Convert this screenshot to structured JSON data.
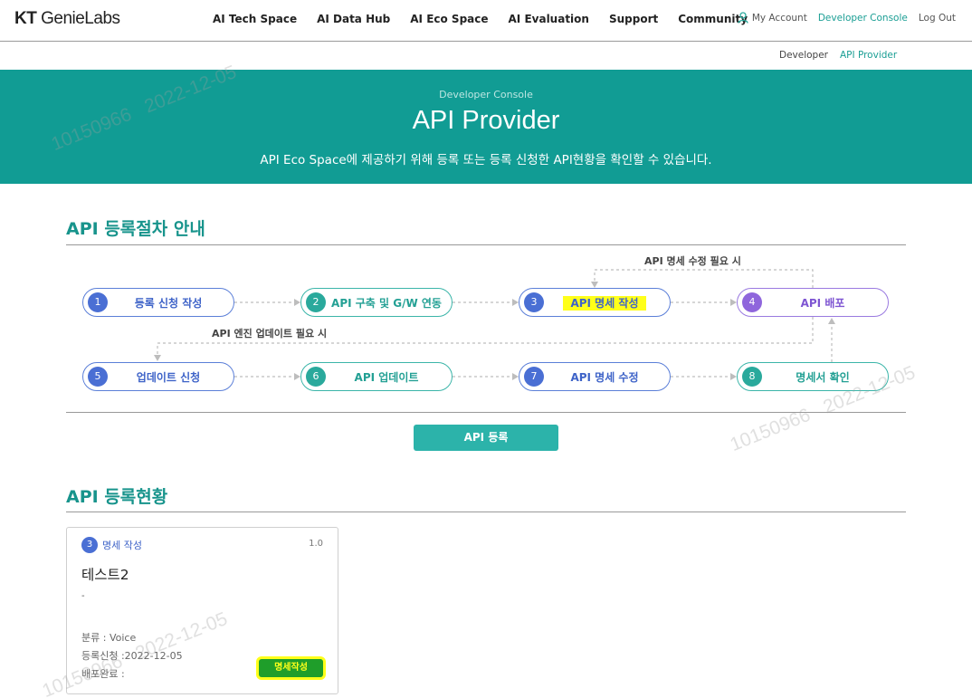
{
  "header": {
    "logo_prefix": "KT",
    "logo_name": "GenieLabs",
    "nav": [
      "AI Tech Space",
      "AI Data Hub",
      "AI Eco Space",
      "AI Evaluation",
      "Support",
      "Community"
    ],
    "my_account": "My Account",
    "developer_console": "Developer Console",
    "log_out": "Log Out"
  },
  "subnav": {
    "developer": "Developer",
    "api_provider": "API Provider"
  },
  "hero": {
    "eyebrow": "Developer Console",
    "title": "API Provider",
    "description": "API Eco Space에 제공하기 위해 등록 또는 등록 신청한 API현황을 확인할 수 있습니다."
  },
  "procedure": {
    "title": "API 등록절차 안내",
    "steps": [
      {
        "num": "1",
        "label": "등록 신청 작성"
      },
      {
        "num": "2",
        "label": "API 구축 및 G/W 연동"
      },
      {
        "num": "3",
        "label": "API 명세 작성"
      },
      {
        "num": "4",
        "label": "API 배포"
      },
      {
        "num": "5",
        "label": "업데이트 신청"
      },
      {
        "num": "6",
        "label": "API 업데이트"
      },
      {
        "num": "7",
        "label": "API 명세 수정"
      },
      {
        "num": "8",
        "label": "명세서 확인"
      }
    ],
    "note_spec_fix": "API 명세 수정 필요 시",
    "note_engine_update": "API 엔진 업데이트 필요 시",
    "register_button": "API 등록"
  },
  "status": {
    "title": "API 등록현황",
    "card": {
      "step_num": "3",
      "step_label": "명세 작성",
      "version": "1.0",
      "name": "테스트2",
      "desc": "-",
      "category": "분류 : Voice",
      "request_date": "등록신청 :2022-12-05",
      "deploy_done": "배포완료 :",
      "action": "명세작성"
    }
  },
  "watermark": {
    "id": "10150966",
    "date": "2022-12-05"
  },
  "colors": {
    "teal": "#119c94",
    "step_blue": "#4a6fd4",
    "step_teal": "#2aa99c",
    "step_purple": "#8f66dc",
    "highlight": "#ffff1a"
  }
}
